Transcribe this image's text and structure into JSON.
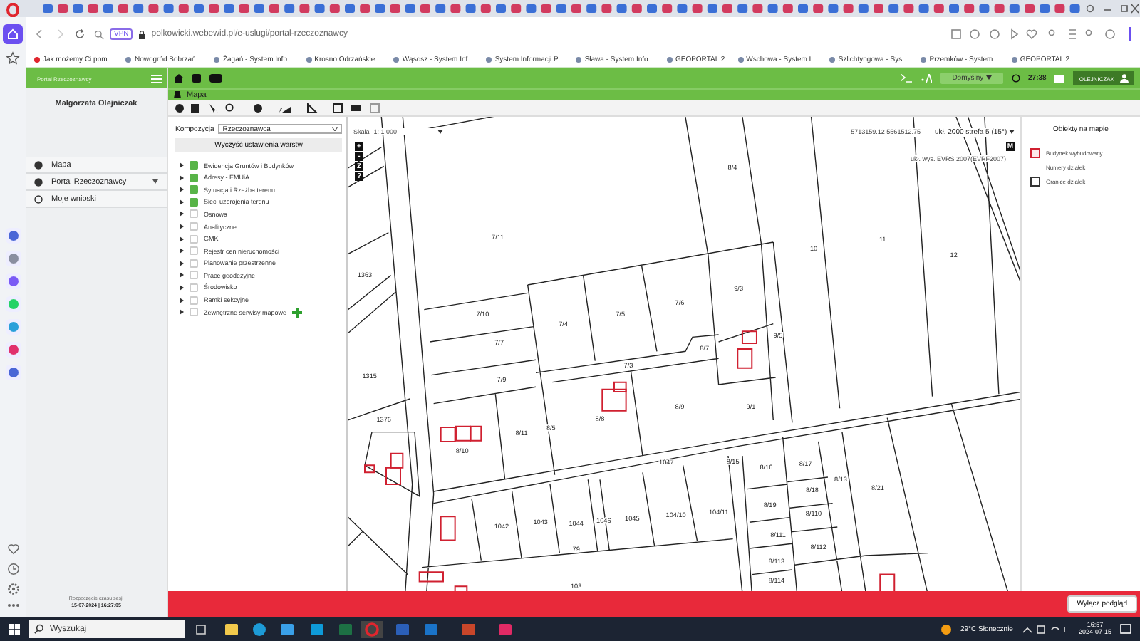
{
  "browser": {
    "url": "polkowicki.webewid.pl/e-uslugi/portal-rzeczoznawcy",
    "vpn_badge": "VPN",
    "bookmarks": [
      "Jak możemy Ci pom...",
      "Nowogród Bobrzań...",
      "Żagań - System Info...",
      "Krosno Odrzańskie...",
      "Wąsosz - System Inf...",
      "System Informacji P...",
      "Sława - System Info...",
      "GEOPORTAL 2",
      "Wschowa - System I...",
      "Szlichtyngowa - Sys...",
      "Przemków - System...",
      "GEOPORTAL 2"
    ]
  },
  "app": {
    "brand": "Portal Rzeczoznawcy",
    "user_name": "Małgorzata Olejniczak",
    "nav": [
      {
        "label": "Mapa",
        "kind": "link"
      },
      {
        "label": "Portal Rzeczoznawcy",
        "kind": "menu"
      },
      {
        "label": "Moje wnioski",
        "kind": "link"
      }
    ],
    "session_label": "Rozpoczęcie czasu sesji",
    "session_time": "15-07-2024 | 16:27:05",
    "profile": "Domyślny",
    "timer": "27:38",
    "user_button": "OLEJNICZAK",
    "section_title": "Mapa"
  },
  "layers_panel": {
    "composition_label": "Kompozycja",
    "composition": "Rzeczoznawca",
    "clear_button": "Wyczyść ustawienia warstw",
    "layers": [
      {
        "label": "Ewidencja Gruntów i Budynków",
        "checked": true,
        "add_button": false
      },
      {
        "label": "Adresy - EMUiA",
        "checked": true,
        "add_button": false
      },
      {
        "label": "Sytuacja i Rzeźba terenu",
        "checked": true,
        "add_button": false
      },
      {
        "label": "Sieci uzbrojenia terenu",
        "checked": true,
        "add_button": false
      },
      {
        "label": "Osnowa",
        "checked": false,
        "add_button": false
      },
      {
        "label": "Analityczne",
        "checked": false,
        "add_button": false
      },
      {
        "label": "GMK",
        "checked": false,
        "add_button": false
      },
      {
        "label": "Rejestr cen nieruchomości",
        "checked": false,
        "add_button": false
      },
      {
        "label": "Planowanie przestrzenne",
        "checked": false,
        "add_button": false
      },
      {
        "label": "Prace geodezyjne",
        "checked": false,
        "add_button": false
      },
      {
        "label": "Środowisko",
        "checked": false,
        "add_button": false
      },
      {
        "label": "Ramki sekcyjne",
        "checked": false,
        "add_button": false
      },
      {
        "label": "Zewnętrzne serwisy mapowe",
        "checked": false,
        "add_button": true
      }
    ]
  },
  "map": {
    "scale_label": "Skala",
    "scale": "1: 1 000",
    "coordinates": "5713159.12  5561512.75",
    "crs": "ukł. 2000 strefa 5 (15°)",
    "vertical_crs": "ukł. wys. EVRS 2007(EVRF2007)",
    "m_badge": "M",
    "map_buttons": [
      "+",
      "-",
      "Z",
      "?"
    ],
    "parcel_labels": [
      "7/11",
      "8/4",
      "10",
      "11",
      "12",
      "1363",
      "7/10",
      "7/4",
      "7/5",
      "7/6",
      "9/3",
      "9/5",
      "7/7",
      "7/3",
      "8/7",
      "1315",
      "7/9",
      "1376",
      "8/11",
      "8/5",
      "8/8",
      "8/9",
      "9/1",
      "8/10",
      "1047",
      "8/15",
      "8/16",
      "8/17",
      "8/13",
      "8/21",
      "1042",
      "1043",
      "1044",
      "1046",
      "1045",
      "104/10",
      "104/11",
      "8/19",
      "8/18",
      "8/110",
      "8/111",
      "8/112",
      "8/113",
      "8/114",
      "79",
      "103"
    ]
  },
  "legend": {
    "title": "Obiekty na mapie",
    "items": [
      {
        "label": "Budynek wybudowany",
        "kind": "building"
      },
      {
        "label": "Numery działek",
        "kind": "text"
      },
      {
        "label": "Granice działek",
        "kind": "boundary"
      }
    ]
  },
  "preview_bar": {
    "button": "Wyłącz podgląd"
  },
  "taskbar": {
    "search": "Wyszukaj",
    "weather": "29°C  Słonecznie",
    "time": "16:57",
    "date": "2024-07-15"
  }
}
